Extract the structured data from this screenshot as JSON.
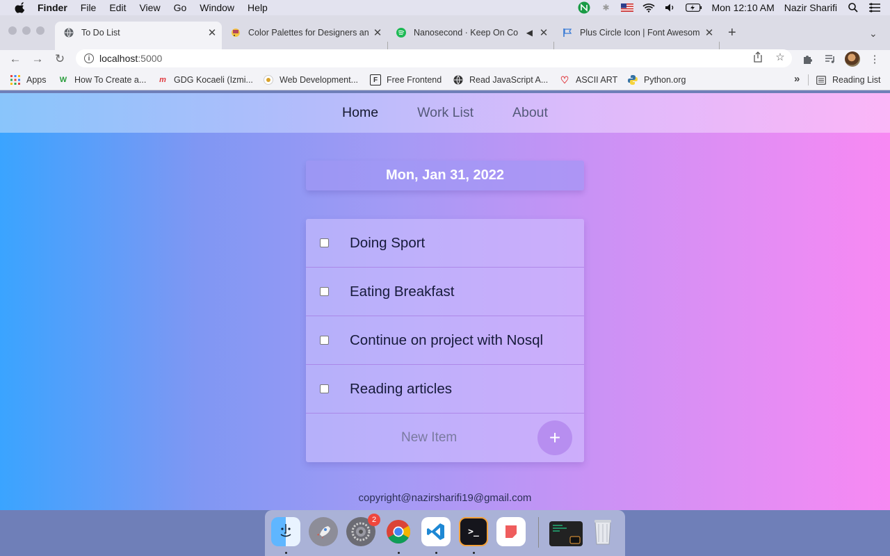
{
  "menubar": {
    "app_name": "Finder",
    "menus": [
      "File",
      "Edit",
      "View",
      "Go",
      "Window",
      "Help"
    ],
    "clock": "Mon 12:10 AM",
    "user": "Nazir Sharifi"
  },
  "browser": {
    "tabs": [
      {
        "title": "To Do List",
        "active": true
      },
      {
        "title": "Color Palettes for Designers an",
        "active": false
      },
      {
        "title": "Nanosecond · Keep On Co",
        "active": false
      },
      {
        "title": "Plus Circle Icon | Font Awesom",
        "active": false
      }
    ],
    "url_host": "localhost",
    "url_port": ":5000",
    "bookmarks": [
      "Apps",
      "How To Create a...",
      "GDG Kocaeli (Izmi...",
      "Web Development...",
      "Free Frontend",
      "Read JavaScript A...",
      "ASCII ART",
      "Python.org"
    ],
    "reading_list": "Reading List"
  },
  "page": {
    "nav": [
      "Home",
      "Work List",
      "About"
    ],
    "date": "Mon, Jan 31, 2022",
    "items": [
      "Doing Sport",
      "Eating Breakfast",
      "Continue on project with Nosql",
      "Reading articles"
    ],
    "new_item_placeholder": "New Item",
    "add_button": "+",
    "footer": "copyright@nazirsharifi19@gmail.com"
  },
  "dock": {
    "badge_count": "2"
  },
  "colors": {
    "gradient_left": "#3aa4ff",
    "gradient_right": "#f889f3",
    "add_button": "#b78ef0"
  }
}
